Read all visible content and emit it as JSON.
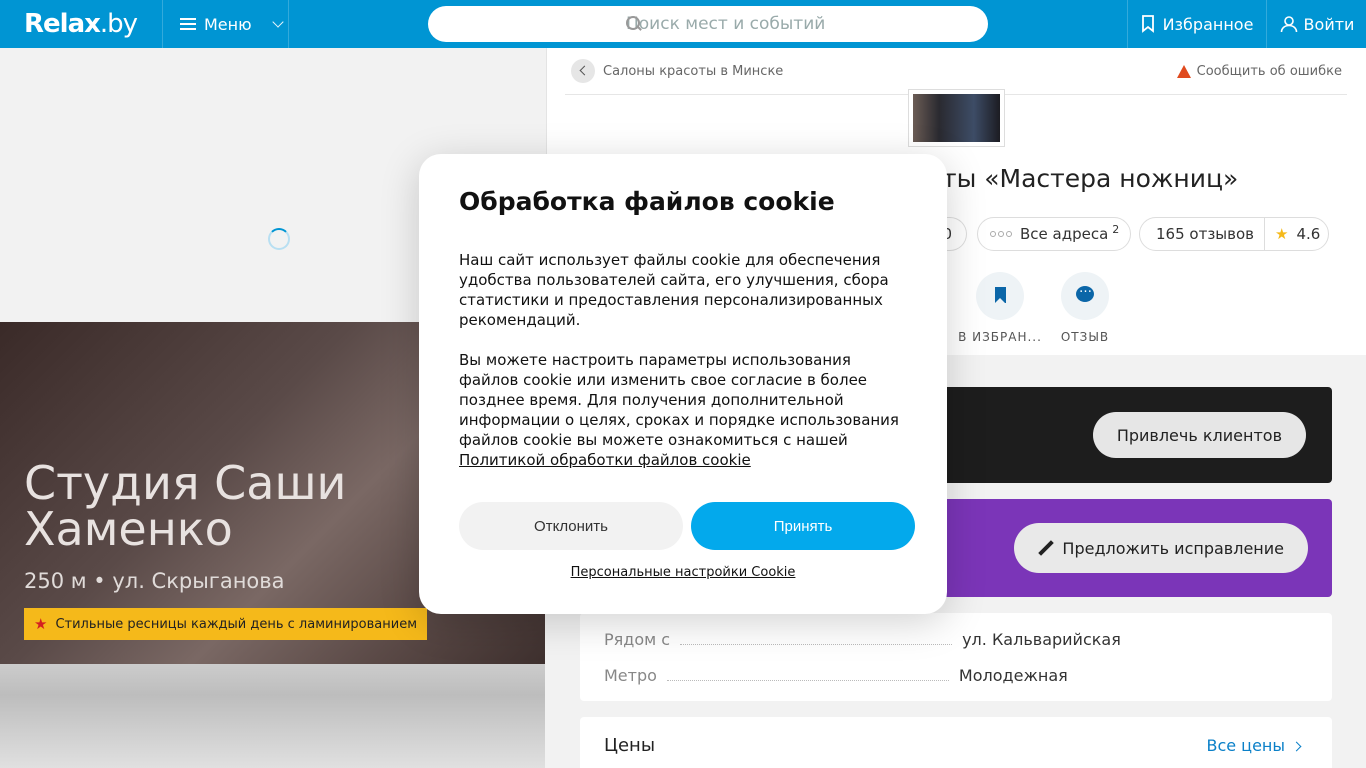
{
  "header": {
    "logo_main": "Relax",
    "logo_suffix": ".by",
    "menu_label": "Меню",
    "search_placeholder": "Поиск мест и событий",
    "favorites_label": "Избранное",
    "login_label": "Войти",
    "brand_color": "#0095d3"
  },
  "hero": {
    "title": "Студия Саши Хаменко",
    "subtitle": "250 м • ул. Скрыганова",
    "promo_text": "Стильные ресницы каждый день с ламинированием"
  },
  "place": {
    "breadcrumb": "Салоны красоты в Минске",
    "report_error": "Сообщить об ошибке",
    "title_visible": "ты «Мастера ножниц»",
    "chip_partial": "0",
    "all_addresses": "Все адреса",
    "addresses_count": "2",
    "reviews": "165 отзывов",
    "rating": "4.6",
    "action_favorite": "В ИЗБРАН...",
    "action_review": "ОТЗЫВ"
  },
  "cards": {
    "attract_button": "Привлечь клиентов",
    "suggest_button": "Предложить исправление",
    "info": [
      {
        "key": "Рядом с",
        "value": "ул. Кальварийская"
      },
      {
        "key": "Метро",
        "value": "Молодежная"
      }
    ],
    "prices_title": "Цены",
    "prices_link": "Все цены"
  },
  "cookie_modal": {
    "title": "Обработка файлов cookie",
    "paragraph1": "Наш сайт использует файлы cookie для обеспечения удобства пользователей сайта, его улучшения, сбора статистики и предоставления персонализированных рекомендаций.",
    "paragraph2": "Вы можете настроить параметры использования файлов cookie или изменить свое согласие в более позднее время. Для получения дополнительной информации о целях, сроках и порядке использования файлов cookie вы можете ознакомиться с нашей",
    "policy_link": "Политикой обработки файлов cookie",
    "decline_button": "Отклонить",
    "accept_button": "Принять",
    "settings_link": "Персональные настройки Cookie",
    "accept_color": "#03a9ec"
  }
}
